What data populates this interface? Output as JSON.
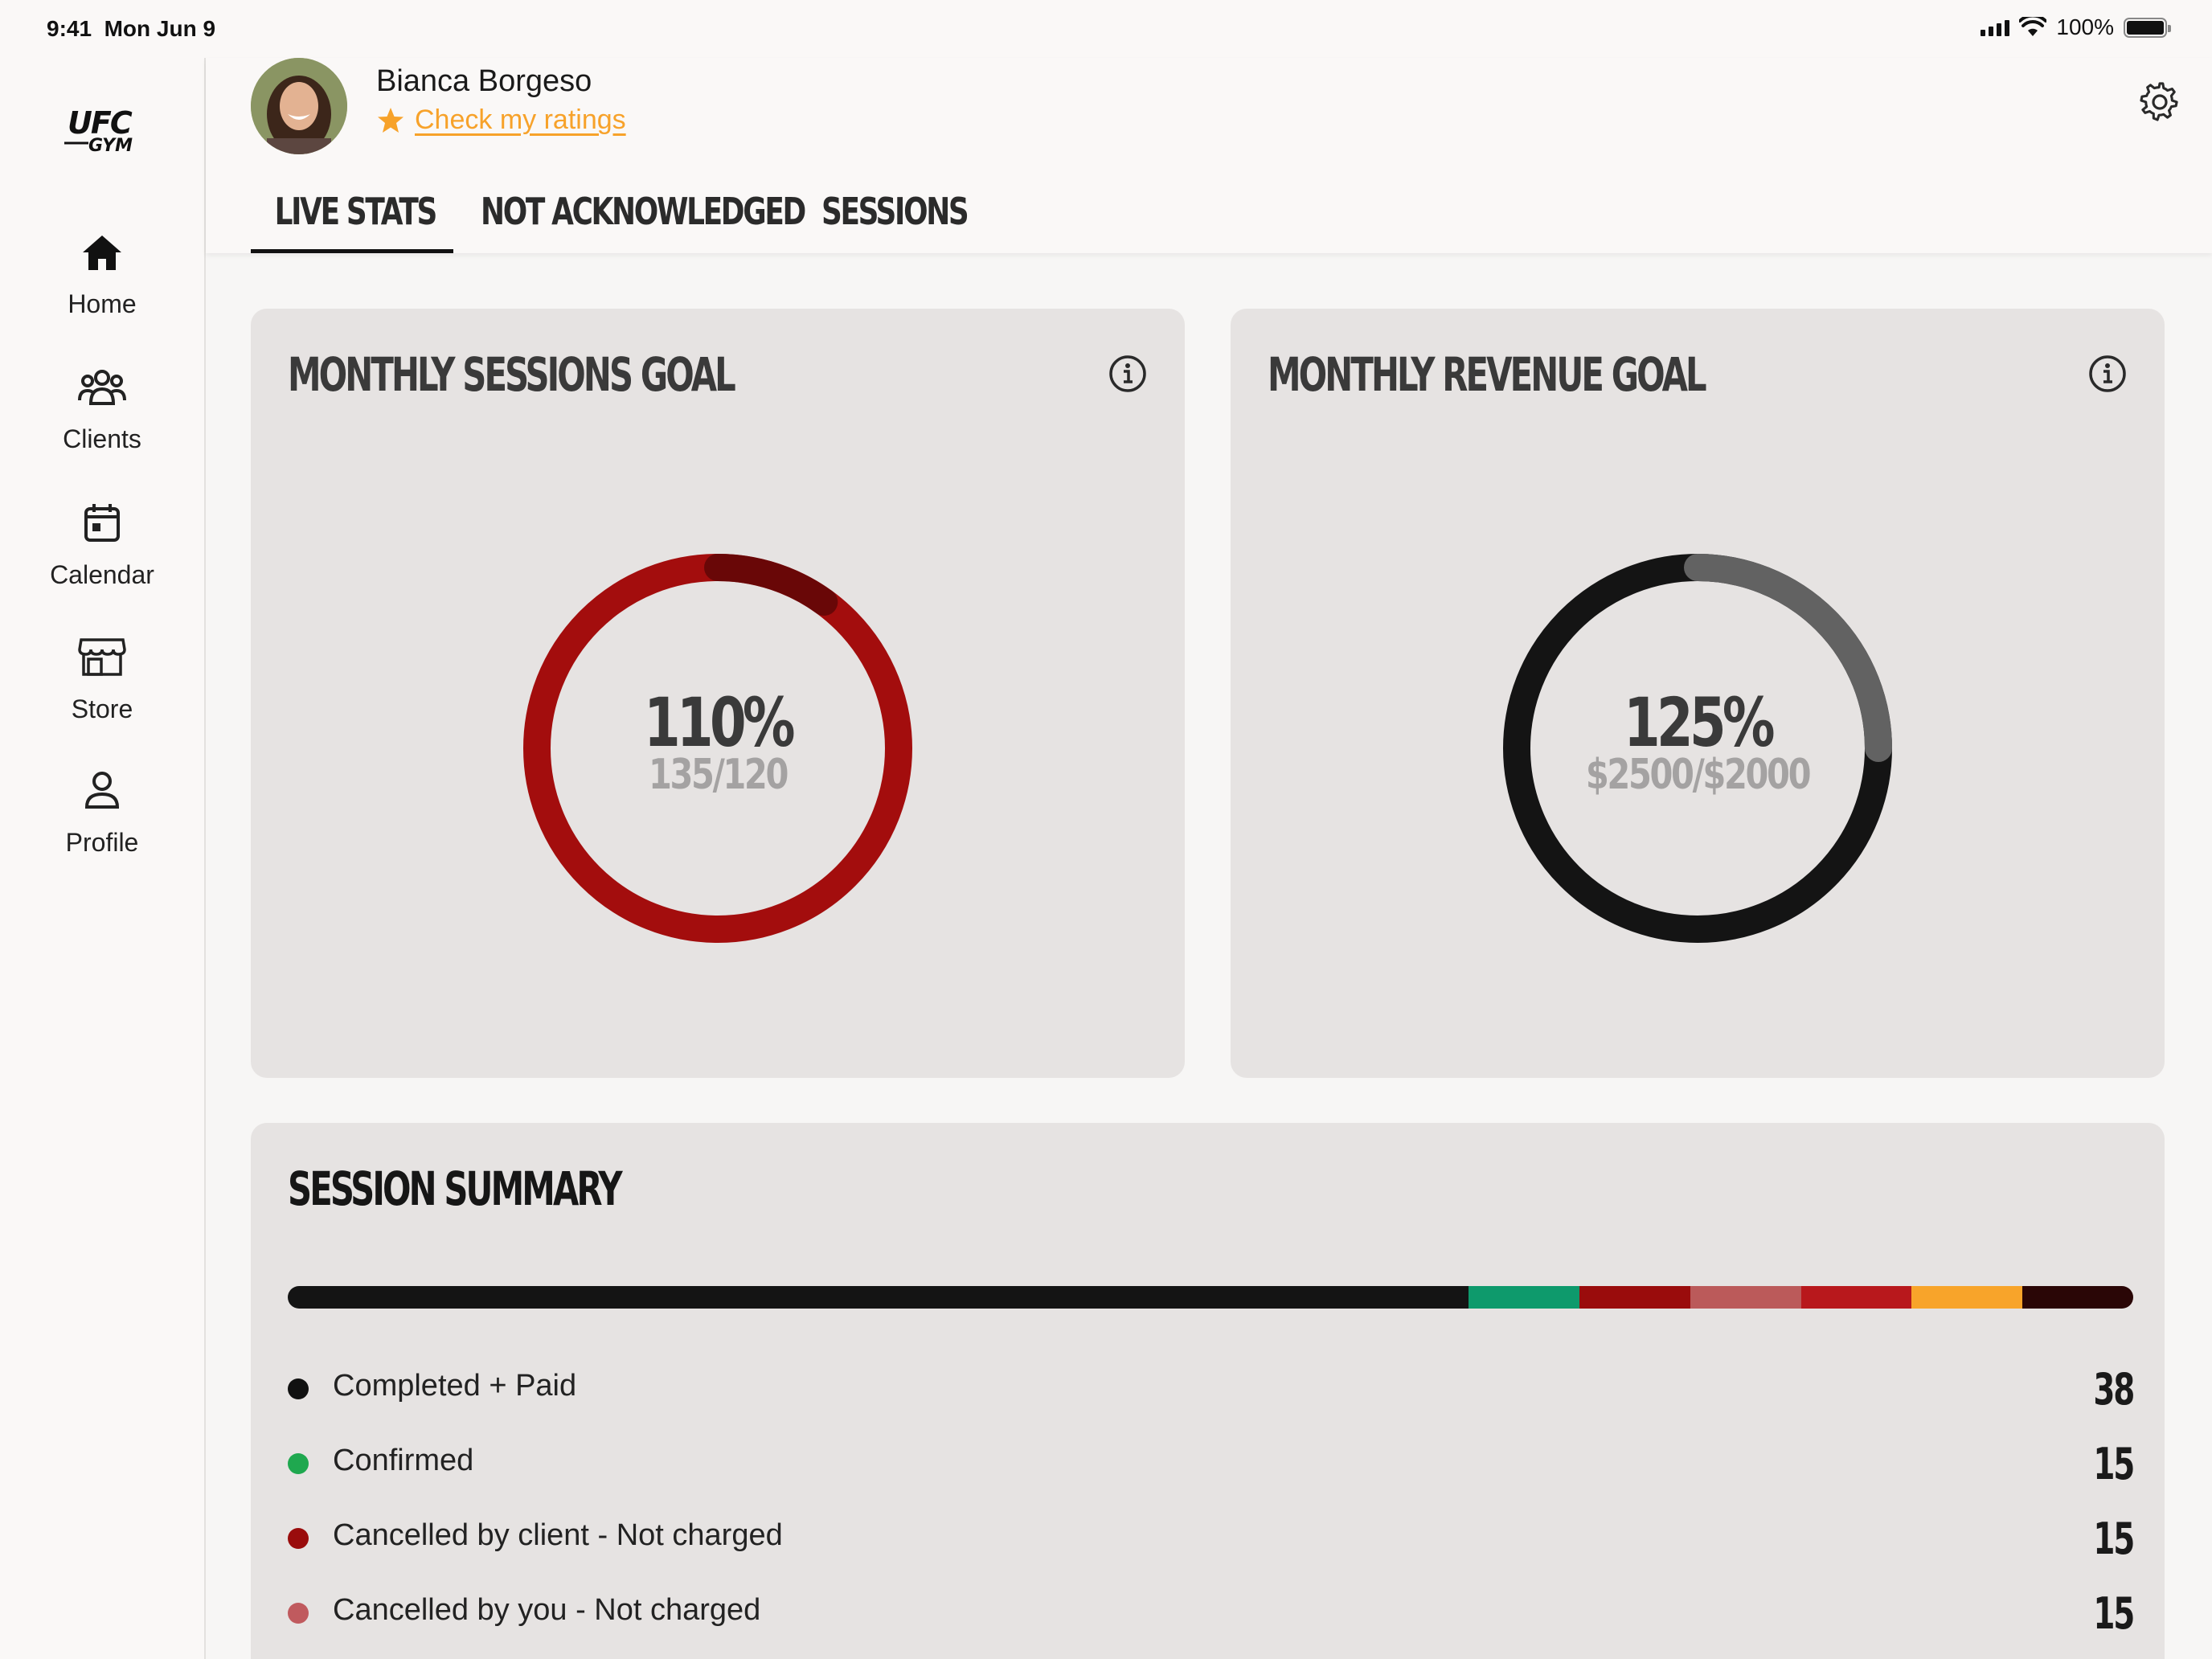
{
  "status_bar": {
    "time": "9:41",
    "date": "Mon Jun 9",
    "battery": "100%"
  },
  "brand": {
    "name": "UFC GYM"
  },
  "sidebar": {
    "items": [
      {
        "label": "Home",
        "icon": "home-icon"
      },
      {
        "label": "Clients",
        "icon": "clients-icon"
      },
      {
        "label": "Calendar",
        "icon": "calendar-icon"
      },
      {
        "label": "Store",
        "icon": "store-icon"
      },
      {
        "label": "Profile",
        "icon": "profile-icon"
      }
    ],
    "active": "Home"
  },
  "header": {
    "user_name": "Bianca Borgeso",
    "ratings_link": "Check my ratings",
    "tabs": [
      {
        "label": "LIVE STATS",
        "active": true
      },
      {
        "label": "NOT ACKNOWLEDGED",
        "active": false
      },
      {
        "label": "SESSIONS",
        "active": false
      }
    ]
  },
  "sessions_goal": {
    "title": "MONTHLY SESSIONS GOAL",
    "percent": "110%",
    "detail": "135/120",
    "progress": 1.1,
    "color": "#a30d0d"
  },
  "revenue_goal": {
    "title": "MONTHLY REVENUE GOAL",
    "percent": "125%",
    "detail": "$2500/$2000",
    "progress": 1.25,
    "color": "#141414"
  },
  "session_summary": {
    "title": "SESSION SUMMARY",
    "bar_colors": [
      "#141414",
      "#0e9a6c",
      "#9a0c0c",
      "#bb5a5a",
      "#b8181c",
      "#f8a42a",
      "#2a0606"
    ],
    "bar_shares": [
      0.64,
      0.06,
      0.06,
      0.06,
      0.06,
      0.06,
      0.06
    ],
    "items": [
      {
        "label": "Completed + Paid",
        "value": "38",
        "color": "#111111"
      },
      {
        "label": "Confirmed",
        "value": "15",
        "color": "#1fa84f"
      },
      {
        "label": "Cancelled by client - Not charged",
        "value": "15",
        "color": "#9a0c0c"
      },
      {
        "label": "Cancelled by you - Not charged",
        "value": "15",
        "color": "#c05a5e"
      }
    ]
  }
}
